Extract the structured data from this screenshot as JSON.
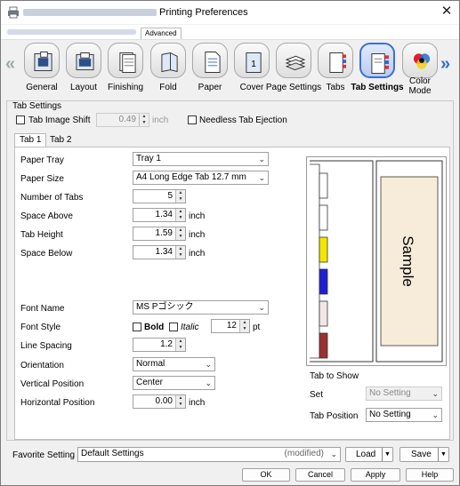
{
  "window": {
    "title": "Printing Preferences",
    "close_glyph": "✕"
  },
  "top_tab": "Advanced",
  "tabs": [
    {
      "label": "General",
      "icon": "general-icon"
    },
    {
      "label": "Layout",
      "icon": "layout-icon"
    },
    {
      "label": "Finishing",
      "icon": "finishing-icon"
    },
    {
      "label": "Fold",
      "icon": "fold-icon"
    },
    {
      "label": "Paper",
      "icon": "paper-icon"
    },
    {
      "label": "Cover",
      "icon": "cover-icon"
    },
    {
      "label": "Page Settings",
      "icon": "page-settings-icon"
    },
    {
      "label": "Tabs",
      "icon": "tabs-icon"
    },
    {
      "label": "Tab Settings",
      "icon": "tab-settings-icon",
      "selected": true
    },
    {
      "label": "Color Mode",
      "icon": "color-mode-icon"
    }
  ],
  "section": {
    "title": "Tab Settings",
    "tab_image_shift_label": "Tab Image Shift",
    "tab_image_shift_value": "0.49",
    "tab_image_shift_unit": "inch",
    "needless_ejection_label": "Needless Tab Ejection"
  },
  "inner_tabs": [
    "Tab 1",
    "Tab 2"
  ],
  "form": {
    "paper_tray": {
      "label": "Paper Tray",
      "value": "Tray 1"
    },
    "paper_size": {
      "label": "Paper Size",
      "value": "A4 Long Edge Tab 12.7 mm"
    },
    "number_of_tabs": {
      "label": "Number of Tabs",
      "value": "5"
    },
    "space_above": {
      "label": "Space Above",
      "value": "1.34",
      "unit": "inch"
    },
    "tab_height": {
      "label": "Tab Height",
      "value": "1.59",
      "unit": "inch"
    },
    "space_below": {
      "label": "Space Below",
      "value": "1.34",
      "unit": "inch"
    },
    "font_name": {
      "label": "Font Name",
      "value": "MS Pゴシック"
    },
    "font_style": {
      "label": "Font Style",
      "bold": "Bold",
      "italic": "Italic",
      "size": "12",
      "unit": "pt"
    },
    "line_spacing": {
      "label": "Line Spacing",
      "value": "1.2"
    },
    "orientation": {
      "label": "Orientation",
      "value": "Normal"
    },
    "vertical_position": {
      "label": "Vertical Position",
      "value": "Center"
    },
    "horizontal_position": {
      "label": "Horizontal Position",
      "value": "0.00",
      "unit": "inch"
    }
  },
  "preview": {
    "sample_text": "Sample",
    "tab_colors": [
      "#ffffff",
      "#ffffff",
      "#f3e600",
      "#1f1fd8",
      "#f3e6e6",
      "#9b3030"
    ],
    "tab_to_show_label": "Tab to Show",
    "set_label": "Set",
    "set_value": "No Setting",
    "tab_position_label": "Tab Position",
    "tab_position_value": "No Setting"
  },
  "favorite": {
    "label": "Favorite Setting",
    "value": "Default Settings",
    "modified": "(modified)",
    "load": "Load",
    "save": "Save"
  },
  "buttons": {
    "ok": "OK",
    "cancel": "Cancel",
    "apply": "Apply",
    "help": "Help"
  }
}
